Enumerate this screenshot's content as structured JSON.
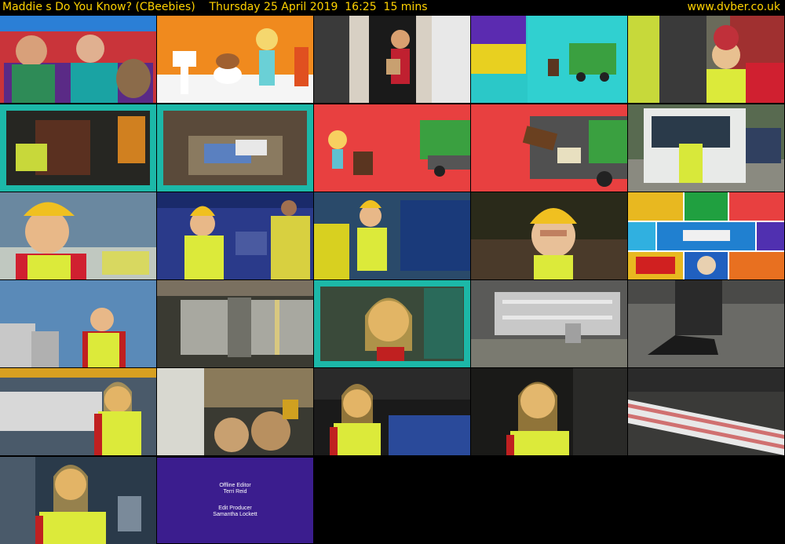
{
  "header": {
    "programme": "Maddie s Do You Know? (CBeebies)",
    "datetime": "Thursday 25 April 2019  16:25",
    "duration": "15 mins",
    "site": "www.dvber.co.uk"
  },
  "thumbnails": [
    {
      "scene": "studio-presenters-with-dog-puppet"
    },
    {
      "scene": "animated-bathroom-toilet"
    },
    {
      "scene": "presenter-at-doorway"
    },
    {
      "scene": "colour-panels-bin-lorry"
    },
    {
      "scene": "presenter-with-bin-lorry-crew"
    },
    {
      "scene": "bin-emptied-into-lorry"
    },
    {
      "scene": "waste-inside-lorry"
    },
    {
      "scene": "animated-presenter-bin-lorry"
    },
    {
      "scene": "animated-bin-tipping"
    },
    {
      "scene": "bin-lorry-on-street"
    },
    {
      "scene": "presenter-at-recycling-plant"
    },
    {
      "scene": "presenter-with-worker"
    },
    {
      "scene": "presenter-by-machinery"
    },
    {
      "scene": "presenter-hard-hat-glasses"
    },
    {
      "scene": "transport-icons-grid"
    },
    {
      "scene": "presenter-outside-tanks"
    },
    {
      "scene": "rotating-drum"
    },
    {
      "scene": "presenter-framed-closeup"
    },
    {
      "scene": "paper-mill-interior"
    },
    {
      "scene": "boot-in-pulp"
    },
    {
      "scene": "presenter-by-paper-roll"
    },
    {
      "scene": "paper-roll-production"
    },
    {
      "scene": "presenter-at-machine"
    },
    {
      "scene": "presenter-smiling-factory"
    },
    {
      "scene": "newspapers-on-conveyor"
    },
    {
      "scene": "presenter-closing"
    },
    {
      "scene": "end-credits"
    }
  ],
  "credits": {
    "line1_role": "Offline Editor",
    "line1_name": "Terri Reid",
    "line2_role": "Edit Producer",
    "line2_name": "Samantha Lockett"
  }
}
